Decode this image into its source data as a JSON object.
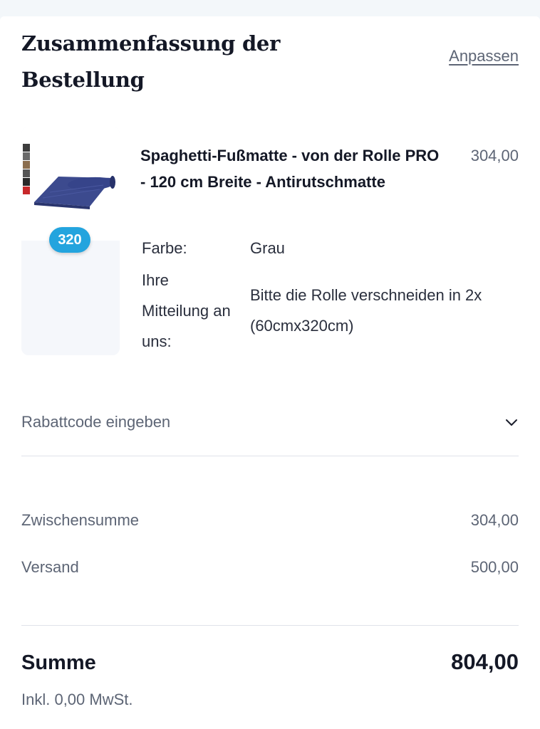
{
  "summary": {
    "title": "Zusammenfassung der Bestellung",
    "edit_link": "Anpassen"
  },
  "item": {
    "image_icon": "spaghetti-mat-roll",
    "swatch_colors": [
      "#3d3d3d",
      "#6a6a6a",
      "#8b6e4e",
      "#555555",
      "#2a2a2a",
      "#c8282a"
    ],
    "quantity_badge": "320",
    "name": "Spaghetti-Fußmatte - von der Rolle PRO - 120 cm Breite - Antirutschmatte",
    "price": "304,00",
    "attributes": [
      {
        "label": "Farbe:",
        "value": "Grau"
      },
      {
        "label": "Ihre Mitteilung an uns:",
        "value": "Bitte die Rolle verschneiden in 2x (60cmx320cm)"
      }
    ]
  },
  "discount": {
    "label": "Rabattcode eingeben",
    "icon": "chevron-down-icon"
  },
  "totals": {
    "subtotal_label": "Zwischensumme",
    "subtotal_value": "304,00",
    "shipping_label": "Versand",
    "shipping_value": "500,00",
    "total_label": "Summe",
    "total_value": "804,00",
    "tax_note": "Inkl. 0,00 MwSt."
  },
  "colors": {
    "badge": "#23a4de",
    "text_primary": "#141826",
    "text_muted": "#5d6575"
  }
}
